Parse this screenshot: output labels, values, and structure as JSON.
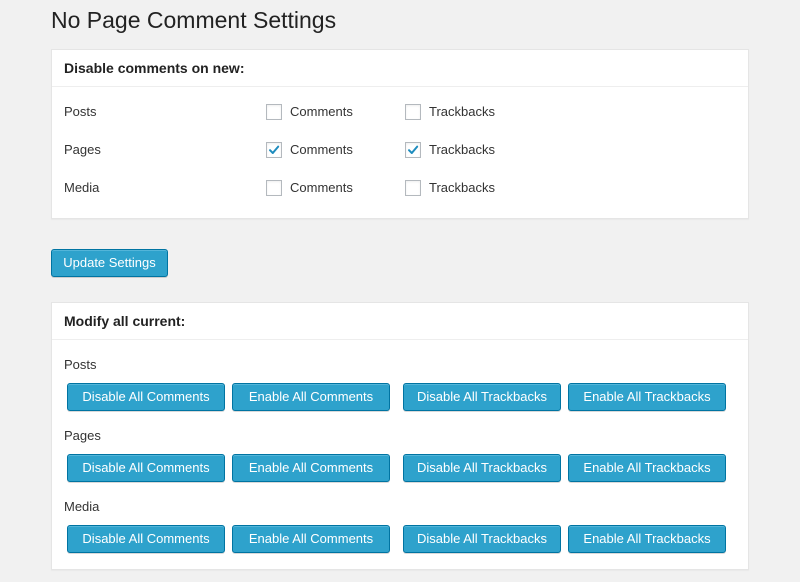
{
  "page": {
    "title": "No Page Comment Settings"
  },
  "new_box": {
    "heading": "Disable comments on new:",
    "rows": [
      {
        "label": "Posts",
        "comments": {
          "label": "Comments",
          "checked": false
        },
        "trackbacks": {
          "label": "Trackbacks",
          "checked": false
        }
      },
      {
        "label": "Pages",
        "comments": {
          "label": "Comments",
          "checked": true
        },
        "trackbacks": {
          "label": "Trackbacks",
          "checked": true
        }
      },
      {
        "label": "Media",
        "comments": {
          "label": "Comments",
          "checked": false
        },
        "trackbacks": {
          "label": "Trackbacks",
          "checked": false
        }
      }
    ]
  },
  "update_button": {
    "label": "Update Settings"
  },
  "current_box": {
    "heading": "Modify all current:",
    "groups": [
      {
        "label": "Posts",
        "buttons": [
          "Disable All Comments",
          "Enable All Comments",
          "Disable All Trackbacks",
          "Enable All Trackbacks"
        ]
      },
      {
        "label": "Pages",
        "buttons": [
          "Disable All Comments",
          "Enable All Comments",
          "Disable All Trackbacks",
          "Enable All Trackbacks"
        ]
      },
      {
        "label": "Media",
        "buttons": [
          "Disable All Comments",
          "Enable All Comments",
          "Disable All Trackbacks",
          "Enable All Trackbacks"
        ]
      }
    ]
  },
  "colors": {
    "button_bg": "#2ea2cc",
    "button_border": "#0074a2",
    "check": "#1e8cbe",
    "background": "#f1f1f1"
  }
}
